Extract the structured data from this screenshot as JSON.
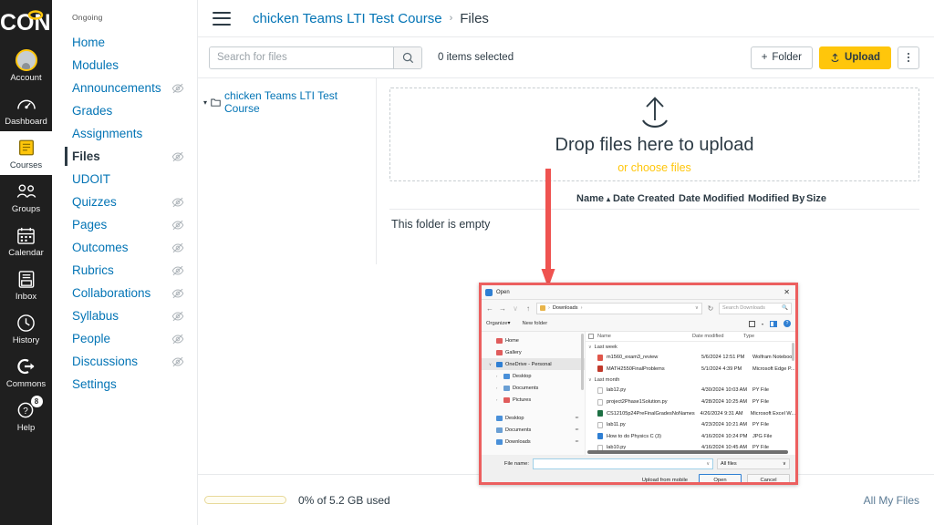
{
  "global_nav": {
    "logo_text": "ICON",
    "items": [
      {
        "label": "Account",
        "icon": "avatar-icon",
        "badge": null,
        "active": false
      },
      {
        "label": "Dashboard",
        "icon": "dashboard-icon",
        "badge": null,
        "active": false
      },
      {
        "label": "Courses",
        "icon": "courses-book-icon",
        "badge": null,
        "active": true
      },
      {
        "label": "Groups",
        "icon": "groups-people-icon",
        "badge": null,
        "active": false
      },
      {
        "label": "Calendar",
        "icon": "calendar-icon",
        "badge": null,
        "active": false
      },
      {
        "label": "Inbox",
        "icon": "inbox-icon",
        "badge": null,
        "active": false
      },
      {
        "label": "History",
        "icon": "clock-icon",
        "badge": null,
        "active": false
      },
      {
        "label": "Commons",
        "icon": "commons-arrow-icon",
        "badge": null,
        "active": false
      },
      {
        "label": "Help",
        "icon": "help-question-icon",
        "badge": "8",
        "active": false
      }
    ]
  },
  "course_nav": {
    "section_label": "Ongoing",
    "items": [
      {
        "label": "Home",
        "hidden": false,
        "active": false
      },
      {
        "label": "Modules",
        "hidden": false,
        "active": false
      },
      {
        "label": "Announcements",
        "hidden": true,
        "active": false
      },
      {
        "label": "Grades",
        "hidden": false,
        "active": false
      },
      {
        "label": "Assignments",
        "hidden": false,
        "active": false
      },
      {
        "label": "Files",
        "hidden": true,
        "active": true
      },
      {
        "label": "UDOIT",
        "hidden": false,
        "active": false
      },
      {
        "label": "Quizzes",
        "hidden": true,
        "active": false
      },
      {
        "label": "Pages",
        "hidden": true,
        "active": false
      },
      {
        "label": "Outcomes",
        "hidden": true,
        "active": false
      },
      {
        "label": "Rubrics",
        "hidden": true,
        "active": false
      },
      {
        "label": "Collaborations",
        "hidden": true,
        "active": false
      },
      {
        "label": "Syllabus",
        "hidden": true,
        "active": false
      },
      {
        "label": "People",
        "hidden": true,
        "active": false
      },
      {
        "label": "Discussions",
        "hidden": true,
        "active": false
      },
      {
        "label": "Settings",
        "hidden": false,
        "active": false
      }
    ]
  },
  "breadcrumb": {
    "course": "chicken Teams LTI Test Course",
    "separator": "›",
    "current": "Files"
  },
  "toolbar": {
    "search_placeholder": "Search for files",
    "search_value": "",
    "items_selected": "0 items selected",
    "folder_button": "Folder",
    "folder_icon": "plus-icon",
    "upload_button": "Upload",
    "upload_icon": "upload-arrow-icon",
    "kebab_icon": "kebab-menu-icon"
  },
  "folder_tree": {
    "root_label": "chicken Teams LTI Test Course",
    "caret": "▾",
    "folder_icon": "folder-icon"
  },
  "dropzone": {
    "icon": "upload-tray-icon",
    "title": "Drop files here to upload",
    "link": "or choose files"
  },
  "files_table": {
    "columns": [
      "Name",
      "Date Created",
      "Date Modified",
      "Modified By",
      "Size"
    ],
    "sort_indicator": "▴",
    "empty_message": "This folder is empty",
    "rows": []
  },
  "usage": {
    "quota_text": "0% of 5.2 GB used",
    "quota_percent": 0,
    "all_my_files": "All My Files"
  },
  "annotation": {
    "arrow_color": "#ef5350",
    "highlight_color": "#ec5f5f"
  },
  "file_dialog": {
    "title": "Open",
    "close_icon": "close-icon",
    "nav": {
      "back_icon": "←",
      "forward_icon": "→",
      "recent_icon": "∨",
      "up_icon": "↑",
      "path_folder": "Downloads",
      "path_sep": "›",
      "dropdown_icon": "∨",
      "refresh_icon": "↻",
      "search_placeholder": "Search Downloads",
      "search_icon": "search-icon"
    },
    "commands": {
      "organize": "Organize",
      "organize_caret": "▾",
      "new_folder": "New folder",
      "view_icon": "view-layout-icon",
      "view_caret": "▾",
      "preview_pane_icon": "preview-pane-icon",
      "help_icon": "help-icon"
    },
    "sidebar": [
      {
        "label": "Home",
        "icon": "home-icon",
        "color": "#e05c5c",
        "indent": false,
        "chevron": "",
        "selected": false,
        "pinned": false
      },
      {
        "label": "Gallery",
        "icon": "gallery-icon",
        "color": "#e05c5c",
        "indent": false,
        "chevron": "",
        "selected": false,
        "pinned": false
      },
      {
        "label": "OneDrive - Personal",
        "icon": "onedrive-icon",
        "color": "#2f7fd3",
        "indent": false,
        "chevron": "∨",
        "selected": true,
        "pinned": false
      },
      {
        "label": "Desktop",
        "icon": "folder-icon",
        "color": "#4a90d9",
        "indent": true,
        "chevron": "›",
        "selected": false,
        "pinned": false
      },
      {
        "label": "Documents",
        "icon": "documents-icon",
        "color": "#6a9fd4",
        "indent": true,
        "chevron": "›",
        "selected": false,
        "pinned": false
      },
      {
        "label": "Pictures",
        "icon": "pictures-icon",
        "color": "#e05c5c",
        "indent": true,
        "chevron": "›",
        "selected": false,
        "pinned": false
      },
      {
        "label": "Desktop",
        "icon": "folder-icon",
        "color": "#4a90d9",
        "indent": false,
        "chevron": "",
        "selected": false,
        "pinned": true
      },
      {
        "label": "Documents",
        "icon": "documents-icon",
        "color": "#6a9fd4",
        "indent": false,
        "chevron": "",
        "selected": false,
        "pinned": true
      },
      {
        "label": "Downloads",
        "icon": "download-icon",
        "color": "#4a90d9",
        "indent": false,
        "chevron": "",
        "selected": false,
        "pinned": true
      }
    ],
    "list_columns": [
      "Name",
      "Date modified",
      "Type"
    ],
    "groups": [
      {
        "label": "Last week",
        "chevron": "∨",
        "files": [
          {
            "name": "m1560_exam3_review",
            "date": "5/6/2024 12:51 PM",
            "type": "Wolfram Notebook",
            "icon_color": "#e0564a"
          },
          {
            "name": "MATH2550FinalProblems",
            "date": "5/1/2024 4:39 PM",
            "type": "Microsoft Edge P...",
            "icon_color": "#c0392b"
          }
        ]
      },
      {
        "label": "Last month",
        "chevron": "∨",
        "files": [
          {
            "name": "lab12.py",
            "date": "4/30/2024 10:03 AM",
            "type": "PY File",
            "icon_color": "#ffffff"
          },
          {
            "name": "project2Phase1Solution.py",
            "date": "4/28/2024 10:25 AM",
            "type": "PY File",
            "icon_color": "#ffffff"
          },
          {
            "name": "CS12105p24PreFinalGradesNoNames",
            "date": "4/26/2024 9:31 AM",
            "type": "Microsoft Excel W...",
            "icon_color": "#1d7044"
          },
          {
            "name": "lab11.py",
            "date": "4/23/2024 10:21 AM",
            "type": "PY File",
            "icon_color": "#ffffff"
          },
          {
            "name": "How to do Physics C (3)",
            "date": "4/16/2024 10:24 PM",
            "type": "JPG File",
            "icon_color": "#2f7fd3"
          },
          {
            "name": "lab10.py",
            "date": "4/16/2024 10:45 AM",
            "type": "PY File",
            "icon_color": "#ffffff"
          }
        ]
      }
    ],
    "footer": {
      "file_name_label": "File name:",
      "file_name_value": "",
      "file_name_caret": "∨",
      "filter_value": "All files",
      "filter_caret": "∨",
      "upload_from_mobile": "Upload from mobile",
      "open_button": "Open",
      "cancel_button": "Cancel"
    }
  }
}
